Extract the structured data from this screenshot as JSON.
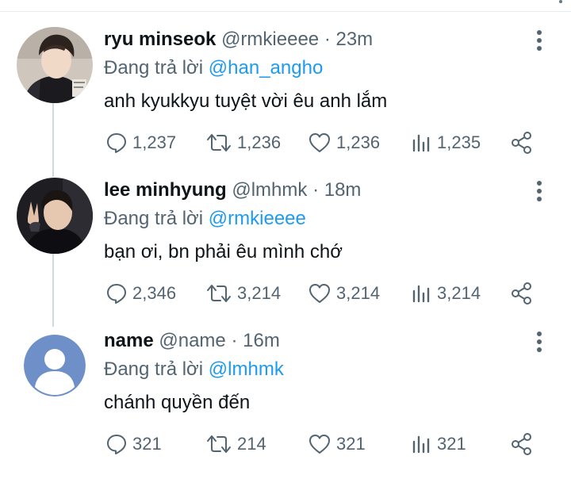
{
  "tweets": [
    {
      "name": "ryu minseok",
      "handle": "@rmkieeee",
      "separator": "·",
      "time": "23m",
      "reply_prefix": "Đang trả lời",
      "reply_handle": "@han_angho",
      "text": "anh kyukkyu tuyệt vời êu anh lắm",
      "replies": "1,237",
      "retweets": "1,236",
      "likes": "1,236",
      "views": "1,235",
      "avatar": "photo"
    },
    {
      "name": "lee minhyung",
      "handle": "@lmhmk",
      "separator": "·",
      "time": "18m",
      "reply_prefix": "Đang trả lời",
      "reply_handle": "@rmkieeee",
      "text": "bạn ơi, bn phải êu mình chớ",
      "replies": "2,346",
      "retweets": "3,214",
      "likes": "3,214",
      "views": "3,214",
      "avatar": "photo"
    },
    {
      "name": "name",
      "handle": "@name",
      "separator": "·",
      "time": "16m",
      "reply_prefix": "Đang trả lời",
      "reply_handle": "@lmhmk",
      "text": "chánh quyền đến",
      "replies": "321",
      "retweets": "214",
      "likes": "321",
      "views": "321",
      "avatar": "default-user"
    }
  ],
  "icons": {
    "more": "more-vertical-icon",
    "reply": "reply-icon",
    "retweet": "retweet-icon",
    "like": "heart-icon",
    "views": "views-bar-chart-icon",
    "share": "share-icon"
  },
  "colors": {
    "link": "#1d9bf0",
    "secondary_text": "#536471",
    "primary_text": "#0f1419",
    "thread_line": "#cfd9de",
    "default_avatar_bg": "#6f8fc9"
  }
}
